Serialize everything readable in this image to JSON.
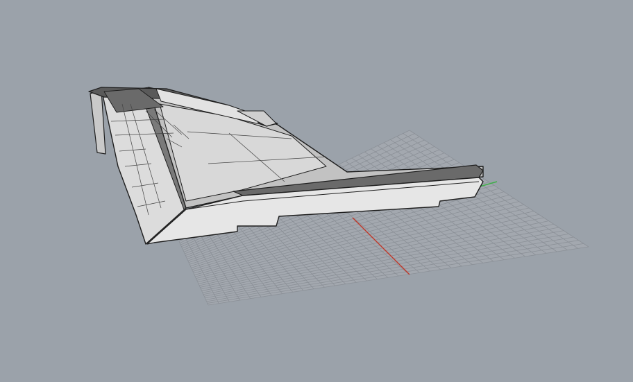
{
  "viewport": {
    "background_color": "#9ba2aa",
    "grid_color": "#8b9097",
    "grid_fill": "#a3a8af",
    "x_axis_color": "#c0392b",
    "y_axis_color": "#3fae49",
    "model_fill_light": "#e8e8e8",
    "model_fill_mid": "#cfcfcf",
    "model_fill_dark": "#6a6a6a",
    "model_edge": "#1e1e1e",
    "mesh_line": "#444444"
  }
}
